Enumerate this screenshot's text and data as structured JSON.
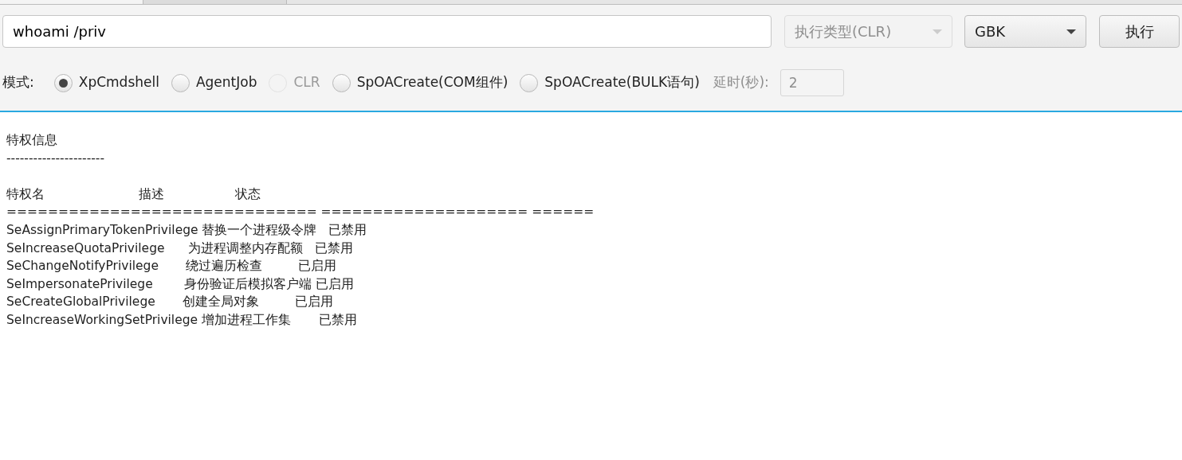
{
  "command": {
    "value": "whoami /priv"
  },
  "exec_type": {
    "value": "执行类型(CLR)",
    "disabled": true
  },
  "encoding": {
    "value": "GBK",
    "disabled": false
  },
  "execute_button": {
    "label": "执行"
  },
  "mode": {
    "label": "模式:",
    "options": [
      {
        "label": "XpCmdshell",
        "selected": true,
        "disabled": false
      },
      {
        "label": "AgentJob",
        "selected": false,
        "disabled": false
      },
      {
        "label": "CLR",
        "selected": false,
        "disabled": true
      },
      {
        "label": "SpOACreate(COM组件)",
        "selected": false,
        "disabled": false
      },
      {
        "label": "SpOACreate(BULK语句)",
        "selected": false,
        "disabled": false
      }
    ]
  },
  "delay": {
    "label": "延时(秒):",
    "value": "2",
    "disabled": true
  },
  "output": [
    {
      "lines": [
        "特权信息",
        "----------------------"
      ]
    },
    {
      "lines": [
        "特权名                        描述                  状态",
        "============================== ==================== ======",
        "SeAssignPrimaryTokenPrivilege 替换一个进程级令牌   已禁用",
        "SeIncreaseQuotaPrivilege      为进程调整内存配额   已禁用",
        "SeChangeNotifyPrivilege       绕过遍历检查         已启用",
        "SeImpersonatePrivilege        身份验证后模拟客户端 已启用",
        "SeCreateGlobalPrivilege       创建全局对象         已启用",
        "SeIncreaseWorkingSetPrivilege 增加进程工作集       已禁用"
      ]
    }
  ]
}
